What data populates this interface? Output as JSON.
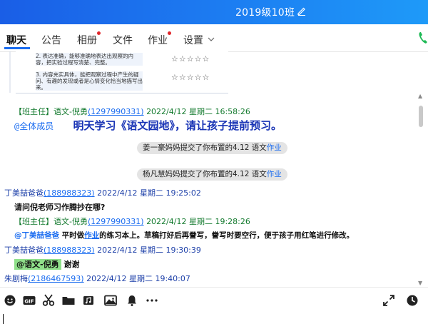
{
  "window": {
    "title": "2019级10班"
  },
  "tabs": [
    {
      "label": "聊天"
    },
    {
      "label": "公告"
    },
    {
      "label": "相册"
    },
    {
      "label": "文件"
    },
    {
      "label": "作业"
    },
    {
      "label": "设置"
    }
  ],
  "shared_image": {
    "rows": [
      {
        "text": "2. 表达准确，能够准确地表达出观察的内容，把实验过程写清楚、完整。",
        "stars": "☆☆☆☆☆"
      },
      {
        "text": "3. 内容充实具体，能把观察过程中产生的疑问、有趣的发现或者是心情变化恰当地描写出来。",
        "stars": "☆☆☆☆☆"
      }
    ]
  },
  "messages": [
    {
      "role": "【班主任】",
      "sender": "语文-倪勇",
      "sender_id": "(1297990331)",
      "time": "2022/4/12 星期二 16:58:26",
      "mention": "@全体成员",
      "text": "明天学习《语文园地》，请让孩子提前预习。"
    },
    {
      "system": "姜一豪妈妈提交了你布置的4.12  语文",
      "link": "作业"
    },
    {
      "system": "杨凡慧妈妈提交了你布置的4.12  语文",
      "link": "作业"
    },
    {
      "sender": "丁美喆爸爸",
      "sender_id": "(188988323)",
      "time": "2022/4/12 星期二 19:25:02",
      "text": "请问倪老师习作腾抄在哪?"
    },
    {
      "role": "【班主任】",
      "sender": "语文-倪勇",
      "sender_id": "(1297990331)",
      "time": "2022/4/12 星期二 19:28:26",
      "mention": "@丁美喆爸爸",
      "text_before": " 平时做",
      "link": "作业",
      "text_after": "的练习本上。草稿打好后再誊写，誊写时要空行，便于孩子用红笔进行修改。"
    },
    {
      "sender": "丁美喆爸爸",
      "sender_id": "(188988323)",
      "time": "2022/4/12 星期二 19:30:39",
      "mention": "@语文-倪勇",
      "text": " 谢谢"
    },
    {
      "sender": "朱剧梅",
      "sender_id": "(2186467593)",
      "time": "2022/4/12 星期二 19:40:07"
    }
  ],
  "toolbar": {
    "left_icons": [
      "emoji-icon",
      "gif-icon",
      "scissors-icon",
      "folder-icon",
      "music-icon",
      "image-icon",
      "bell-icon",
      "more-icon"
    ],
    "right_icons": [
      "expand-icon",
      "history-clock-icon"
    ]
  },
  "colors": {
    "titlebar_start": "#1a5ee6",
    "titlebar_end": "#1e9af8",
    "accent": "#1a6cf0",
    "head_green": "#137a2e",
    "head_blue": "#1c3fa8",
    "notify_dot": "#e0262a",
    "phone_green": "#1db954"
  }
}
